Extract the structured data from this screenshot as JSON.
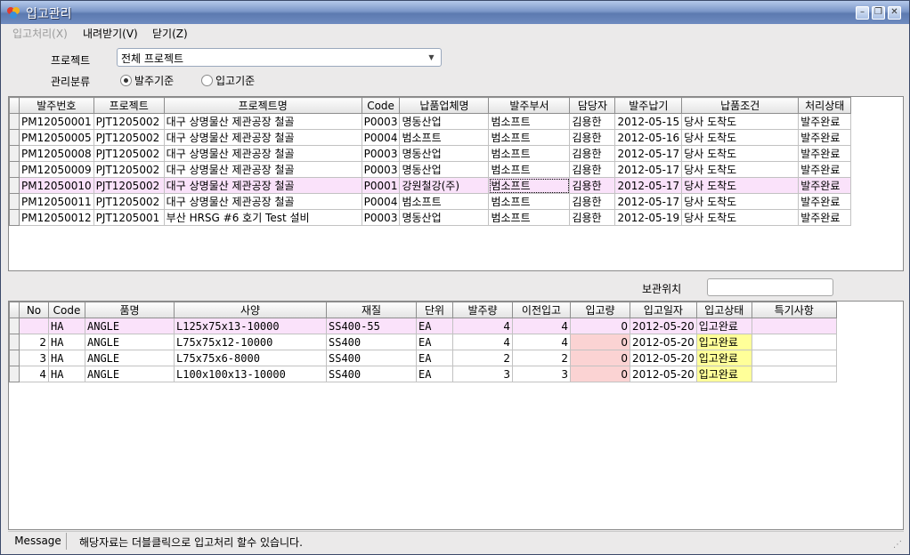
{
  "window": {
    "title": "입고관리"
  },
  "menu": [
    {
      "label": "입고처리(X)",
      "disabled": true
    },
    {
      "label": "내려받기(V)",
      "disabled": false
    },
    {
      "label": "닫기(Z)",
      "disabled": false
    }
  ],
  "filter": {
    "project_label": "프로젝트",
    "project_value": "전체 프로젝트",
    "class_label": "관리분류",
    "radio_order": "발주기준",
    "radio_receipt": "입고기준",
    "selected": "발주기준"
  },
  "orders": {
    "headers": [
      "발주번호",
      "프로젝트",
      "프로젝트명",
      "Code",
      "납품업체명",
      "발주부서",
      "담당자",
      "발주납기",
      "납품조건",
      "처리상태"
    ],
    "rows": [
      [
        "PM12050001",
        "PJT1205002",
        "대구 상명물산 제관공장 철골",
        "P0003",
        "명동산업",
        "범소프트",
        "김용한",
        "2012-05-15",
        "당사 도착도",
        "발주완료"
      ],
      [
        "PM12050005",
        "PJT1205002",
        "대구 상명물산 제관공장 철골",
        "P0004",
        "범소프트",
        "범소프트",
        "김용한",
        "2012-05-16",
        "당사 도착도",
        "발주완료"
      ],
      [
        "PM12050008",
        "PJT1205002",
        "대구 상명물산 제관공장 철골",
        "P0003",
        "명동산업",
        "범소프트",
        "김용한",
        "2012-05-17",
        "당사 도착도",
        "발주완료"
      ],
      [
        "PM12050009",
        "PJT1205002",
        "대구 상명물산 제관공장 철골",
        "P0003",
        "명동산업",
        "범소프트",
        "김용한",
        "2012-05-17",
        "당사 도착도",
        "발주완료"
      ],
      [
        "PM12050010",
        "PJT1205002",
        "대구 상명물산 제관공장 철골",
        "P0001",
        "강원철강(주)",
        "범소프트",
        "김용한",
        "2012-05-17",
        "당사 도착도",
        "발주완료"
      ],
      [
        "PM12050011",
        "PJT1205002",
        "대구 상명물산 제관공장 철골",
        "P0004",
        "범소프트",
        "범소프트",
        "김용한",
        "2012-05-17",
        "당사 도착도",
        "발주완료"
      ],
      [
        "PM12050012",
        "PJT1205001",
        "부산 HRSG #6 호기 Test 설비",
        "P0003",
        "명동산업",
        "범소프트",
        "김용한",
        "2012-05-19",
        "당사 도착도",
        "발주완료"
      ]
    ],
    "selected_row": 4
  },
  "storage": {
    "label": "보관위치",
    "value": ""
  },
  "details": {
    "headers": [
      "No",
      "Code",
      "품명",
      "사양",
      "재질",
      "단위",
      "발주량",
      "이전입고",
      "입고량",
      "입고일자",
      "입고상태",
      "특기사항"
    ],
    "rows": [
      [
        "",
        "HA",
        "ANGLE",
        "L125x75x13-10000",
        "SS400-55",
        "EA",
        "4",
        "4",
        "0",
        "2012-05-20",
        "입고완료",
        ""
      ],
      [
        "2",
        "HA",
        "ANGLE",
        "L75x75x12-10000",
        "SS400",
        "EA",
        "4",
        "4",
        "0",
        "2012-05-20",
        "입고완료",
        ""
      ],
      [
        "3",
        "HA",
        "ANGLE",
        "L75x75x6-8000",
        "SS400",
        "EA",
        "2",
        "2",
        "0",
        "2012-05-20",
        "입고완료",
        ""
      ],
      [
        "4",
        "HA",
        "ANGLE",
        "L100x100x13-10000",
        "SS400",
        "EA",
        "3",
        "3",
        "0",
        "2012-05-20",
        "입고완료",
        ""
      ]
    ]
  },
  "status": {
    "label": "Message",
    "text": "해당자료는 더블클릭으로 입고처리 할수 있습니다."
  },
  "colors": {
    "selected_row": "#fae2fa",
    "qty_cell": "#fbd3d3",
    "status_cell": "#ffff99"
  }
}
